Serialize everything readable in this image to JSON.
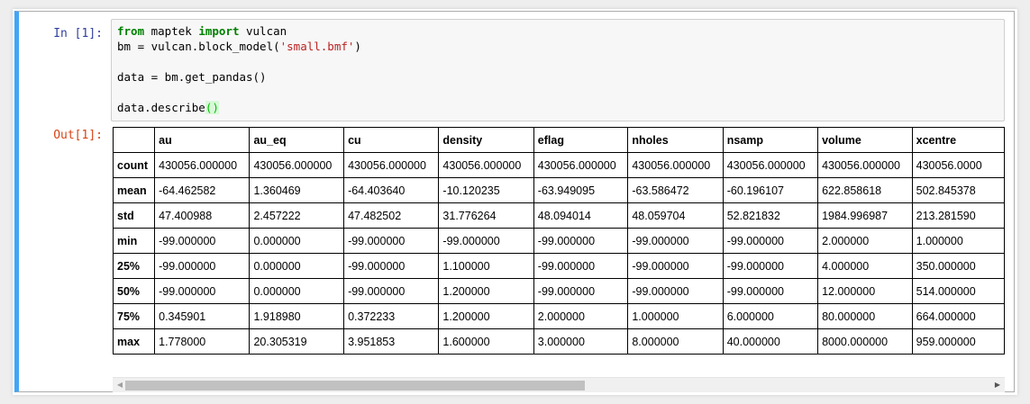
{
  "prompts": {
    "input": "In [1]:",
    "output": "Out[1]:"
  },
  "code": {
    "line1": {
      "kw_from": "from",
      "mod": " maptek ",
      "kw_import": "import",
      "name": " vulcan"
    },
    "line2": {
      "pre": "bm = vulcan.block_model(",
      "str": "'small.bmf'",
      "post": ")"
    },
    "line3": {
      "text": "data = bm.get_pandas()"
    },
    "line4": {
      "pre": "data.describe",
      "parens": "()"
    }
  },
  "table": {
    "columns": [
      "au",
      "au_eq",
      "cu",
      "density",
      "eflag",
      "nholes",
      "nsamp",
      "volume",
      "xcentre"
    ],
    "rows": [
      {
        "label": "count",
        "values": [
          "430056.000000",
          "430056.000000",
          "430056.000000",
          "430056.000000",
          "430056.000000",
          "430056.000000",
          "430056.000000",
          "430056.000000",
          "430056.0000"
        ]
      },
      {
        "label": "mean",
        "values": [
          "-64.462582",
          "1.360469",
          "-64.403640",
          "-10.120235",
          "-63.949095",
          "-63.586472",
          "-60.196107",
          "622.858618",
          "502.845378"
        ]
      },
      {
        "label": "std",
        "values": [
          "47.400988",
          "2.457222",
          "47.482502",
          "31.776264",
          "48.094014",
          "48.059704",
          "52.821832",
          "1984.996987",
          "213.281590"
        ]
      },
      {
        "label": "min",
        "values": [
          "-99.000000",
          "0.000000",
          "-99.000000",
          "-99.000000",
          "-99.000000",
          "-99.000000",
          "-99.000000",
          "2.000000",
          "1.000000"
        ]
      },
      {
        "label": "25%",
        "values": [
          "-99.000000",
          "0.000000",
          "-99.000000",
          "1.100000",
          "-99.000000",
          "-99.000000",
          "-99.000000",
          "4.000000",
          "350.000000"
        ]
      },
      {
        "label": "50%",
        "values": [
          "-99.000000",
          "0.000000",
          "-99.000000",
          "1.200000",
          "-99.000000",
          "-99.000000",
          "-99.000000",
          "12.000000",
          "514.000000"
        ]
      },
      {
        "label": "75%",
        "values": [
          "0.345901",
          "1.918980",
          "0.372233",
          "1.200000",
          "2.000000",
          "1.000000",
          "6.000000",
          "80.000000",
          "664.000000"
        ]
      },
      {
        "label": "max",
        "values": [
          "1.778000",
          "20.305319",
          "3.951853",
          "1.600000",
          "3.000000",
          "8.000000",
          "40.000000",
          "8000.000000",
          "959.000000"
        ]
      }
    ]
  },
  "colors": {
    "cell_border_active": "#42a5f5",
    "input_prompt": "#303f9f",
    "output_prompt": "#d84315",
    "keyword": "#008000",
    "string": "#ba2121"
  },
  "icons": {
    "scroll_left": "arrow-left-icon",
    "scroll_right": "arrow-right-icon"
  }
}
